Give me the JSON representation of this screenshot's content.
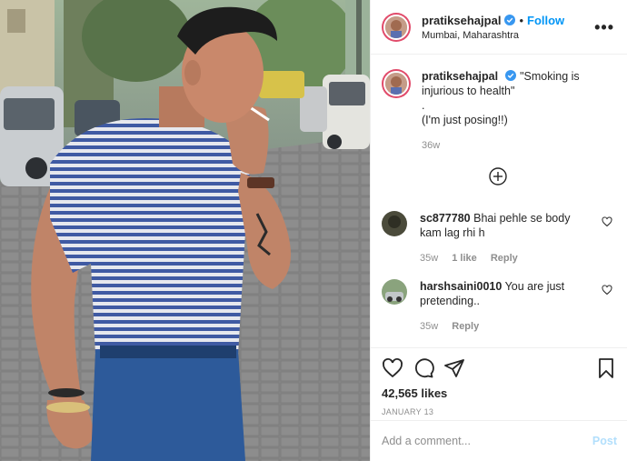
{
  "post": {
    "username": "pratiksehajpal",
    "follow_label": "Follow",
    "separator": "•",
    "location": "Mumbai, Maharashtra",
    "more_label": "•••"
  },
  "caption": {
    "username": "pratiksehajpal",
    "text_line1": "\"Smoking is injurious to health\"",
    "text_line2": ".",
    "text_line3": "(I'm just posing!!)",
    "age": "36w"
  },
  "comments": [
    {
      "username": "sc877780",
      "text": "Bhai pehle se body kam lag rhi h",
      "age": "35w",
      "likes": "1 like",
      "reply_label": "Reply"
    },
    {
      "username": "harshsaini0010",
      "text": "You are just pretending..",
      "age": "35w",
      "reply_label": "Reply"
    }
  ],
  "stats": {
    "likes": "42,565 likes",
    "date": "JANUARY 13"
  },
  "composer": {
    "placeholder": "Add a comment...",
    "post_label": "Post"
  },
  "icons": {
    "like": "heart-icon",
    "comment": "comment-icon",
    "share": "paper-plane-icon",
    "save": "bookmark-icon",
    "verified": "verified-badge-icon",
    "load_more": "plus-circle-icon"
  },
  "colors": {
    "accent": "#0095f6",
    "post_disabled": "#b2dffc",
    "muted": "#8e8e8e",
    "text": "#262626"
  }
}
